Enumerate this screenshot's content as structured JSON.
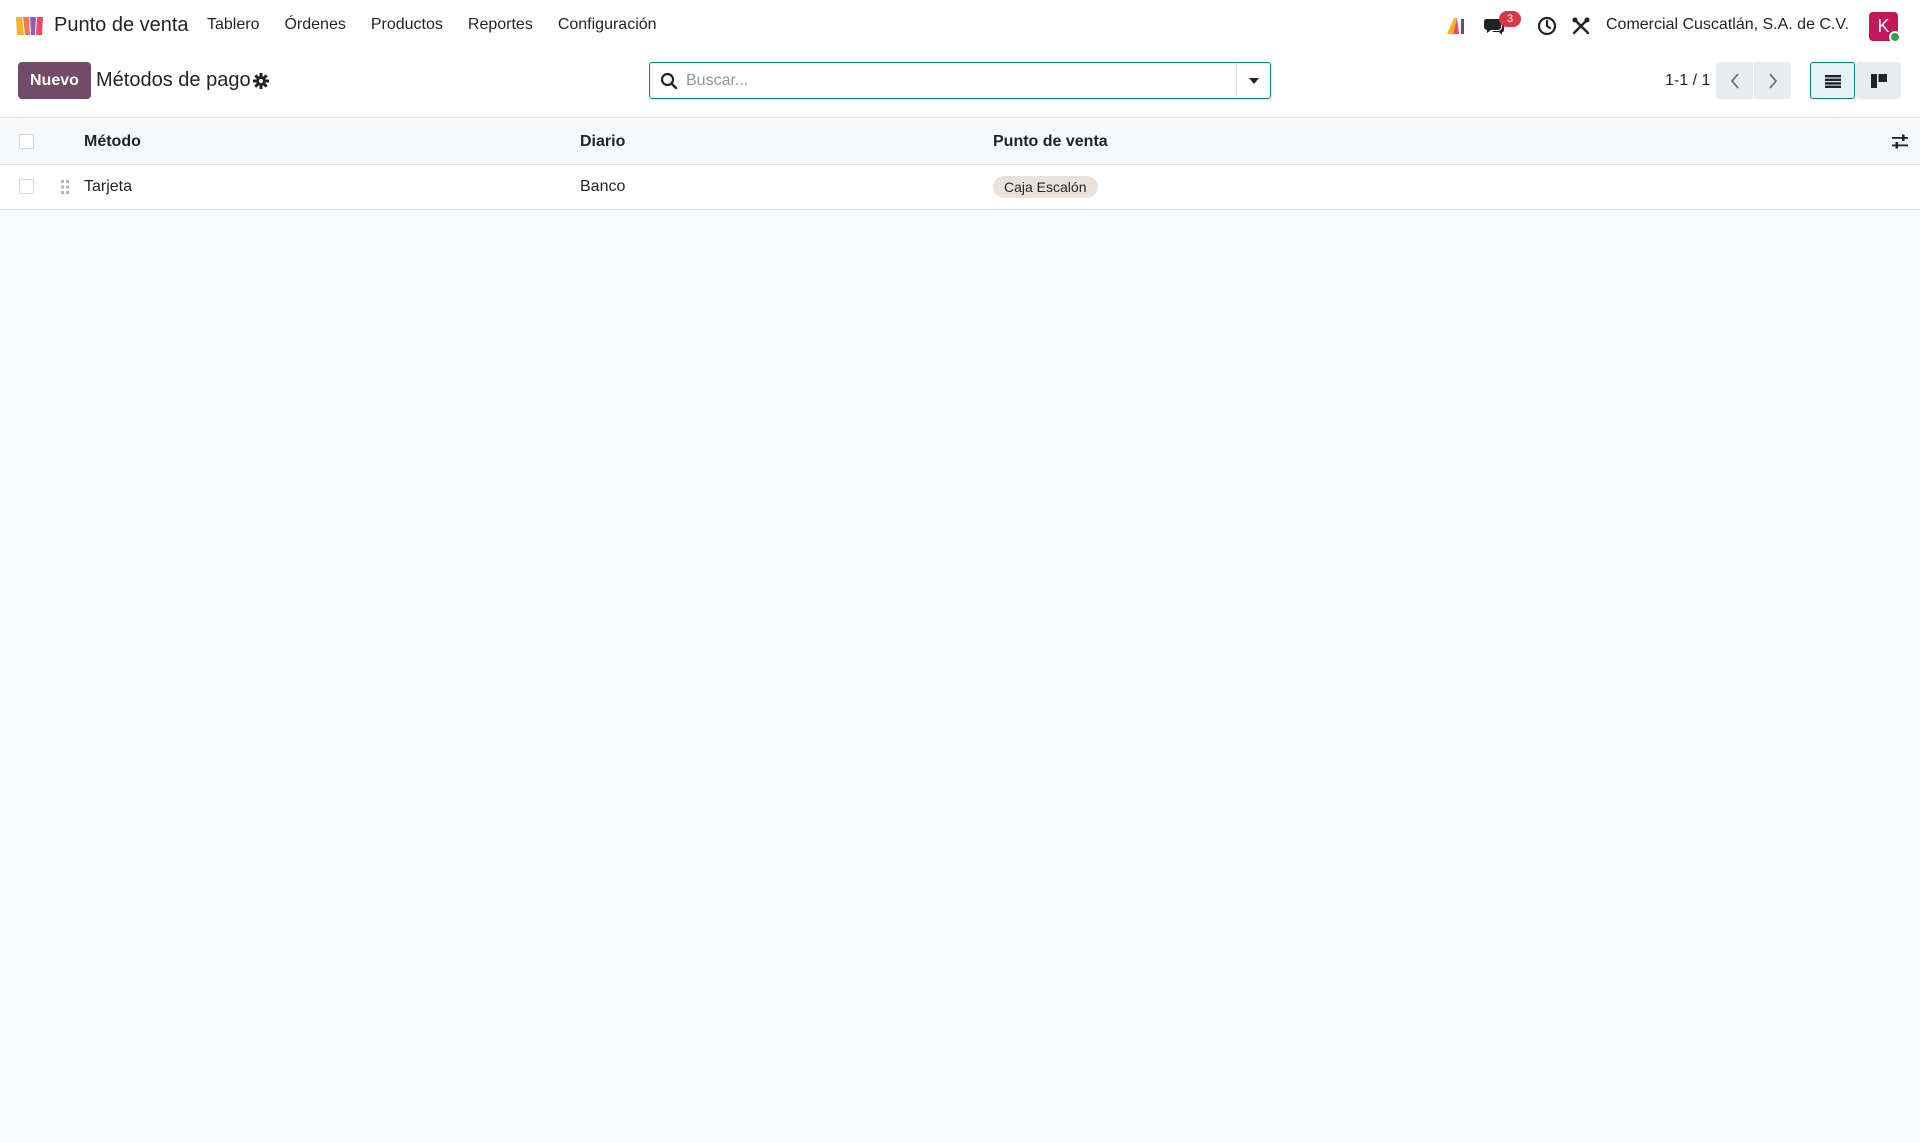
{
  "app": {
    "name": "Punto de venta",
    "menu": [
      "Tablero",
      "Órdenes",
      "Productos",
      "Reportes",
      "Configuración"
    ]
  },
  "systray": {
    "messages_badge": "3",
    "company": "Comercial Cuscatlán, S.A. de C.V.",
    "avatar_initial": "K"
  },
  "control_panel": {
    "new_label": "Nuevo",
    "title": "Métodos de pago",
    "search_placeholder": "Buscar...",
    "pager": "1-1 / 1"
  },
  "table": {
    "columns": [
      "Método",
      "Diario",
      "Punto de venta"
    ],
    "rows": [
      {
        "method": "Tarjeta",
        "journal": "Banco",
        "pos": "Caja Escalón"
      }
    ]
  },
  "colors": {
    "brand": "#714b67",
    "accent": "#017e84",
    "badge": "#dc3545",
    "avatar": "#c2185b"
  }
}
